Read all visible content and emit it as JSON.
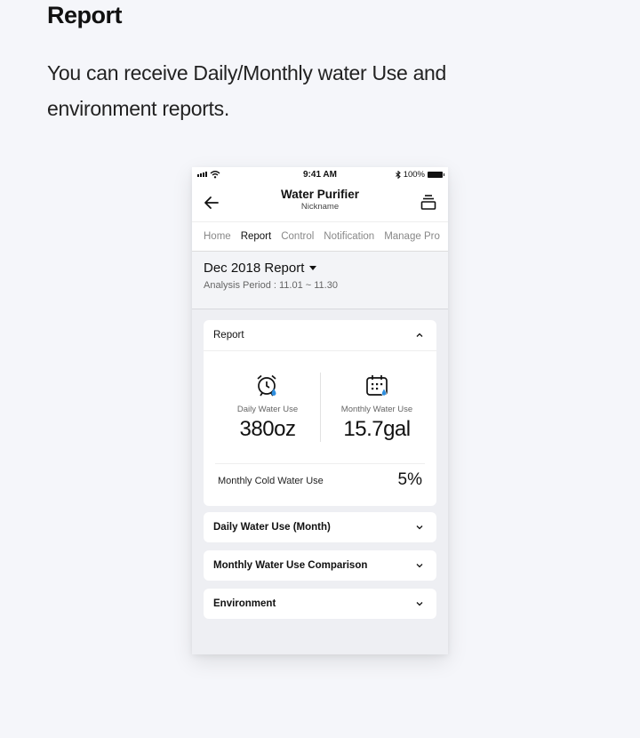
{
  "page": {
    "heading": "Report",
    "description": "You can receive Daily/Monthly water Use and environment reports."
  },
  "statusbar": {
    "time": "9:41 AM",
    "battery": "100%"
  },
  "appbar": {
    "title": "Water Purifier",
    "subtitle": "Nickname",
    "back_icon": "arrow-left-icon",
    "menu_icon": "stack-menu-icon"
  },
  "tabs": [
    {
      "label": "Home",
      "active": false
    },
    {
      "label": "Report",
      "active": true
    },
    {
      "label": "Control",
      "active": false
    },
    {
      "label": "Notification",
      "active": false
    },
    {
      "label": "Manage Pro",
      "active": false
    }
  ],
  "period": {
    "title": "Dec 2018 Report",
    "analysis": "Analysis Period : 11.01 ~ 11.30"
  },
  "report_card": {
    "title": "Report",
    "daily": {
      "label": "Daily Water Use",
      "value": "380oz",
      "icon": "alarm-clock-drop-icon"
    },
    "monthly": {
      "label": "Monthly Water Use",
      "value": "15.7gal",
      "icon": "calendar-drop-icon"
    },
    "cold": {
      "label": "Monthly Cold Water Use",
      "value": "5%"
    }
  },
  "sections": [
    {
      "title": "Daily Water Use (Month)"
    },
    {
      "title": "Monthly Water Use Comparison"
    },
    {
      "title": "Environment"
    }
  ],
  "colors": {
    "accent": "#2e8fe0",
    "background": "#f5f6fa"
  }
}
